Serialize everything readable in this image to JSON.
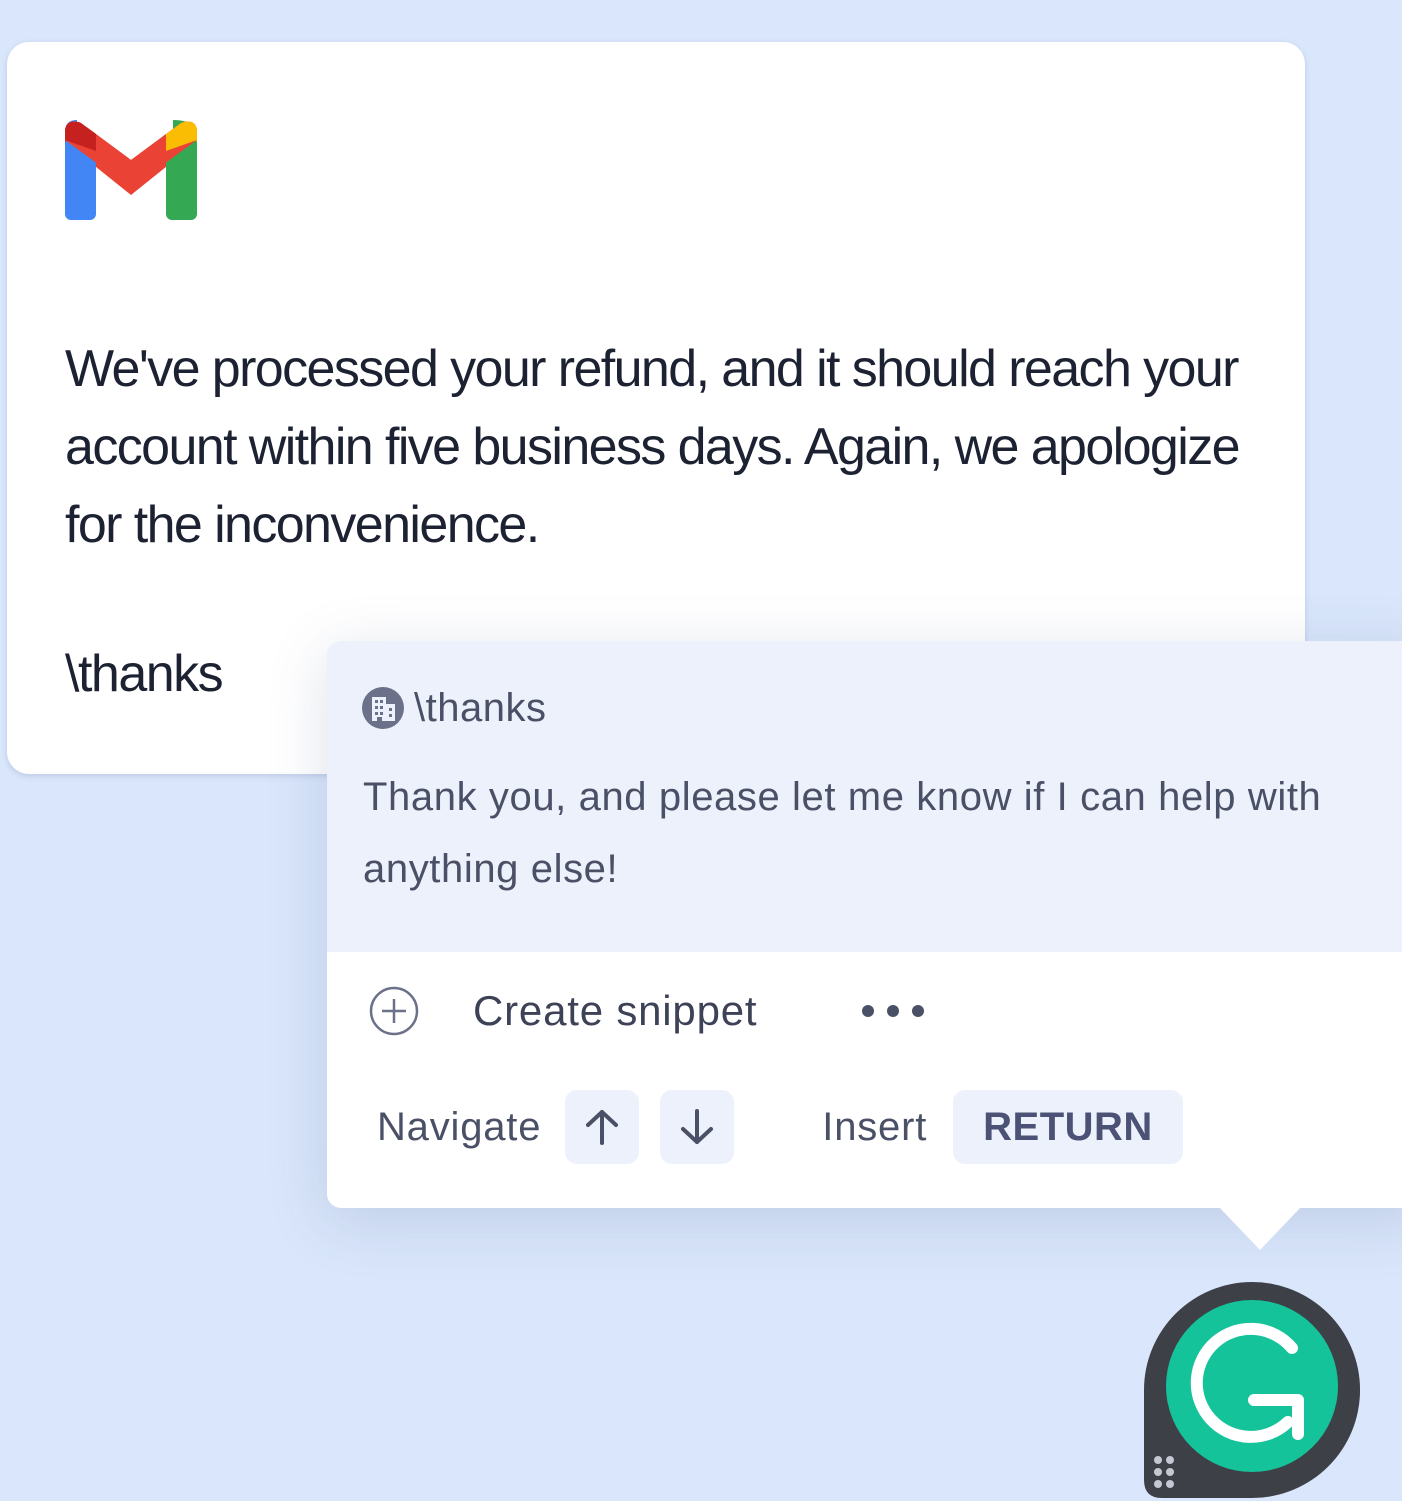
{
  "email": {
    "logo": "gmail-logo",
    "body_text": "We've processed your refund, and it should reach your account within five business days. Again, we apologize for the inconvenience.",
    "typed_shortcut": "\\thanks"
  },
  "snippet_popup": {
    "preview": {
      "icon": "building-icon",
      "shortcut": "\\thanks",
      "text": "Thank you, and please let me know if I can help with anything else!"
    },
    "create_snippet_label": "Create snippet",
    "navigate_label": "Navigate",
    "insert_label": "Insert",
    "insert_key": "RETURN",
    "icons": {
      "create": "plus-circle-icon",
      "more": "more-horizontal-icon",
      "up": "arrow-up-icon",
      "down": "arrow-down-icon"
    }
  },
  "grammarly_button": {
    "icon": "grammarly-g-icon",
    "accent": "#15c39a"
  },
  "colors": {
    "background": "#d9e6fb",
    "card": "#ffffff",
    "preview_bg": "#edf1fb",
    "text_dark": "#1d2233",
    "text_muted": "#4a5066"
  }
}
